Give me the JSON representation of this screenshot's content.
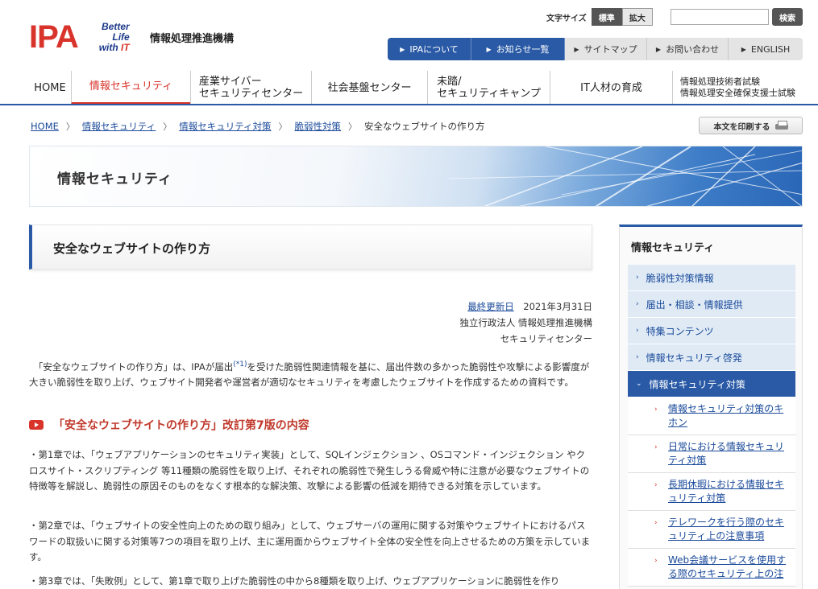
{
  "header": {
    "logo_main": "IPA",
    "logo_tag_line1": "Better Life",
    "logo_tag_line2a": "with ",
    "logo_tag_line2b": "IT",
    "org_name": "情報処理推進機構",
    "font_size_label": "文字サイズ",
    "font_size_standard": "標準",
    "font_size_large": "拡大",
    "search_placeholder": "",
    "search_button": "検索"
  },
  "utility_nav": [
    {
      "label": "IPAについて"
    },
    {
      "label": "お知らせ一覧"
    },
    {
      "label": "サイトマップ"
    },
    {
      "label": "お問い合わせ"
    },
    {
      "label": "ENGLISH"
    }
  ],
  "global_nav": [
    {
      "label": "HOME"
    },
    {
      "label": "情報セキュリティ"
    },
    {
      "label_line1": "産業サイバー",
      "label_line2": "セキュリティセンター"
    },
    {
      "label": "社会基盤センター"
    },
    {
      "label_line1": "未踏/",
      "label_line2": "セキュリティキャンプ"
    },
    {
      "label": "IT人材の育成"
    },
    {
      "label_line1": "情報処理技術者試験",
      "label_line2": "情報処理安全確保支援士試験"
    }
  ],
  "breadcrumb": {
    "items": [
      "HOME",
      "情報セキュリティ",
      "情報セキュリティ対策",
      "脆弱性対策"
    ],
    "current": "安全なウェブサイトの作り方"
  },
  "print_button": "本文を印刷する",
  "banner_title": "情報セキュリティ",
  "page_title": "安全なウェブサイトの作り方",
  "meta": {
    "updated_label": "最終更新日",
    "updated_date": "2021年3月31日",
    "org_line1": "独立行政法人 情報処理推進機構",
    "org_line2": "セキュリティセンター"
  },
  "intro": {
    "part1": "「安全なウェブサイトの作り方」は、IPAが届出",
    "note": "(*1)",
    "part2": "を受けた脆弱性関連情報を基に、届出件数の多かった脆弱性や攻撃による影響度が大きい脆弱性を取り上げ、ウェブサイト開発者や運営者が適切なセキュリティを考慮したウェブサイトを作成するための資料です。"
  },
  "section_heading": "「安全なウェブサイトの作り方」改訂第7版の内容",
  "paragraphs": [
    "・第1章では、「ウェブアプリケーションのセキュリティ実装」として、SQLインジェクション 、OSコマンド・インジェクション やクロスサイト・スクリプティング 等11種類の脆弱性を取り上げ、それぞれの脆弱性で発生しうる脅威や特に注意が必要なウェブサイトの特徴等を解説し、脆弱性の原因そのものをなくす根本的な解決策、攻撃による影響の低減を期待できる対策を示しています。",
    "・第2章では、「ウェブサイトの安全性向上のための取り組み」として、ウェブサーバの運用に関する対策やウェブサイトにおけるパスワードの取扱いに関する対策等7つの項目を取り上げ、主に運用面からウェブサイト全体の安全性を向上させるための方策を示しています。",
    "・第3章では、「失敗例」として、第1章で取り上げた脆弱性の中から8種類を取り上げ、ウェブアプリケーションに脆弱性を作り"
  ],
  "sidebar": {
    "title": "情報セキュリティ",
    "items": [
      {
        "label": "脆弱性対策情報"
      },
      {
        "label": "届出・相談・情報提供"
      },
      {
        "label": "特集コンテンツ"
      },
      {
        "label": "情報セキュリティ啓発"
      },
      {
        "label": "情報セキュリティ対策"
      }
    ],
    "sub_items": [
      {
        "line1": "情報セキュリティ対策のキ",
        "line2": "ホン"
      },
      {
        "line1": "日常における情報セキュリ",
        "line2": "ティ対策"
      },
      {
        "line1": "長期休暇における情報セキ",
        "line2": "ュリティ対策"
      },
      {
        "line1": "テレワークを行う際のセキ",
        "line2": "ュリティ上の注意事項"
      },
      {
        "line1": "Web会議サービスを使用す",
        "line2": "る際のセキュリティ上の注"
      }
    ]
  }
}
